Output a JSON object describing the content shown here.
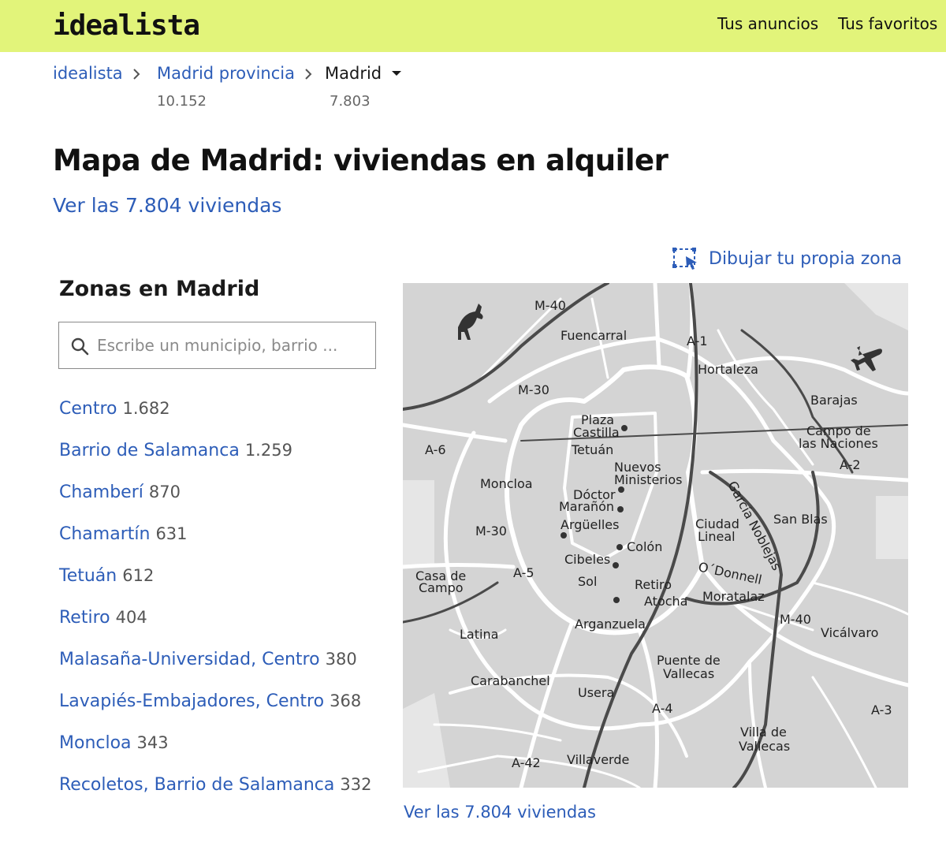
{
  "header": {
    "logo": "idealista",
    "nav": [
      "Tus anuncios",
      "Tus favoritos"
    ]
  },
  "breadcrumb": {
    "items": [
      {
        "label": "idealista",
        "count": ""
      },
      {
        "label": "Madrid provincia",
        "count": "10.152"
      },
      {
        "label": "Madrid",
        "count": "7.803"
      }
    ]
  },
  "page": {
    "title": "Mapa de Madrid: viviendas en alquiler",
    "see_all": "Ver las 7.804 viviendas",
    "draw_zone": "Dibujar tu propia zona"
  },
  "zones": {
    "title": "Zonas en Madrid",
    "search_placeholder": "Escribe un municipio, barrio ...",
    "items": [
      {
        "name": "Centro",
        "count": "1.682"
      },
      {
        "name": "Barrio de Salamanca",
        "count": "1.259"
      },
      {
        "name": "Chamberí",
        "count": "870"
      },
      {
        "name": "Chamartín",
        "count": "631"
      },
      {
        "name": "Tetuán",
        "count": "612"
      },
      {
        "name": "Retiro",
        "count": "404"
      },
      {
        "name": "Malasaña-Universidad, Centro",
        "count": "380"
      },
      {
        "name": "Lavapiés-Embajadores, Centro",
        "count": "368"
      },
      {
        "name": "Moncloa",
        "count": "343"
      },
      {
        "name": "Recoletos, Barrio de Salamanca",
        "count": "332"
      }
    ]
  },
  "map": {
    "labels": {
      "m40_n": "M-40",
      "fuencarral": "Fuencarral",
      "a1": "A-1",
      "hortaleza": "Hortaleza",
      "m30_n": "M-30",
      "barajas": "Barajas",
      "plaza": "Plaza",
      "castilla": "Castilla",
      "tetuan": "Tetuán",
      "campo_de": "Campo de",
      "las_naciones": "las Naciones",
      "a6": "A-6",
      "nuevos": "Nuevos",
      "ministerios": "Ministerios",
      "a2": "A-2",
      "moncloa": "Moncloa",
      "doctor": "Dóctor",
      "maranon": "Marañón",
      "garcia_noblejas": "García Noblejas",
      "arguelles": "Argüelles",
      "ciudad": "Ciudad",
      "lineal": "Lineal",
      "san_blas": "San Blas",
      "m30_w": "M-30",
      "colon": "Colón",
      "casa_de": "Casa de",
      "campo": "Campo",
      "a5": "A-5",
      "cibeles": "Cibeles",
      "odonnell": "O´Donnell",
      "sol": "Sol",
      "retiro": "Retiro",
      "atocha": "Atocha",
      "moratalaz": "Moratalaz",
      "m40_e": "M-40",
      "vicalvaro": "Vicálvaro",
      "arganzuela": "Arganzuela",
      "latina": "Latina",
      "puente_de": "Puente de",
      "vallecas": "Vallecas",
      "carabanchel": "Carabanchel",
      "usera": "Usera",
      "a4": "A-4",
      "a3": "A-3",
      "villa_de": "Villa de",
      "vallecas2": "Vallecas",
      "a42": "A-42",
      "villaverde": "Villaverde"
    }
  },
  "colors": {
    "header_bg": "#e2f47a",
    "link": "#2d5db8",
    "map_bg": "#d4d4d4"
  },
  "icons": [
    "search-icon",
    "draw-zone-icon",
    "chevron-right-icon",
    "caret-down-icon",
    "deer-icon",
    "airplane-icon"
  ]
}
